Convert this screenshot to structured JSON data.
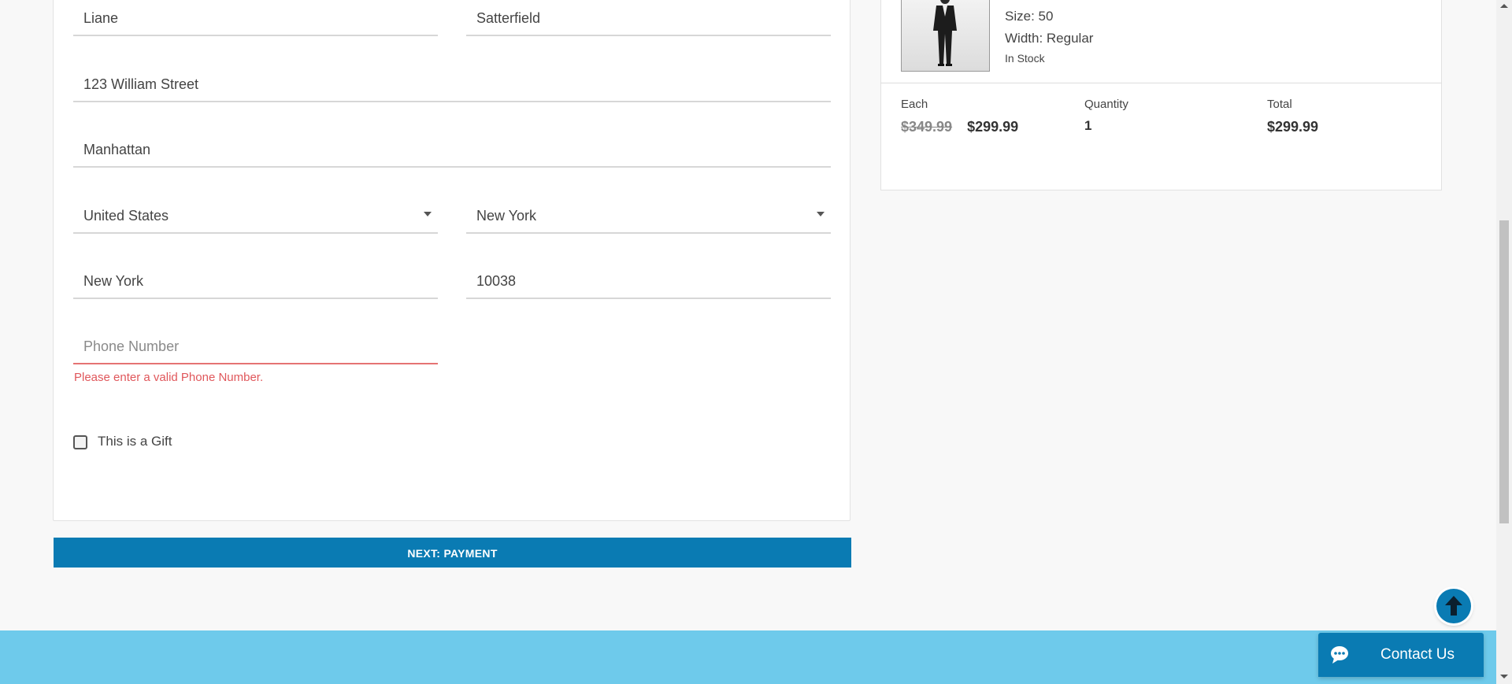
{
  "shipping_form": {
    "first_name": "Liane",
    "last_name": "Satterfield",
    "address": "123 William Street",
    "address2": "Manhattan",
    "country": "United States",
    "state": "New York",
    "city": "New York",
    "zip": "10038",
    "phone_placeholder": "Phone Number",
    "phone_error": "Please enter a valid Phone Number.",
    "gift_label": "This is a Gift",
    "gift_checked": false
  },
  "next_button_label": "NEXT: PAYMENT",
  "order_summary": {
    "size": "Size: 50",
    "width": "Width: Regular",
    "stock": "In Stock",
    "each_label": "Each",
    "quantity_label": "Quantity",
    "total_label": "Total",
    "original_price": "$349.99",
    "sale_price": "$299.99",
    "quantity": "1",
    "total": "$299.99"
  },
  "contact_button_label": "Contact Us",
  "colors": {
    "accent": "#0a7bb3",
    "footer": "#6ecaeb",
    "error": "#e0575b"
  },
  "icons": [
    "chevron-down-icon",
    "arrow-up-icon",
    "chat-bubble-icon",
    "product-suit-image"
  ]
}
